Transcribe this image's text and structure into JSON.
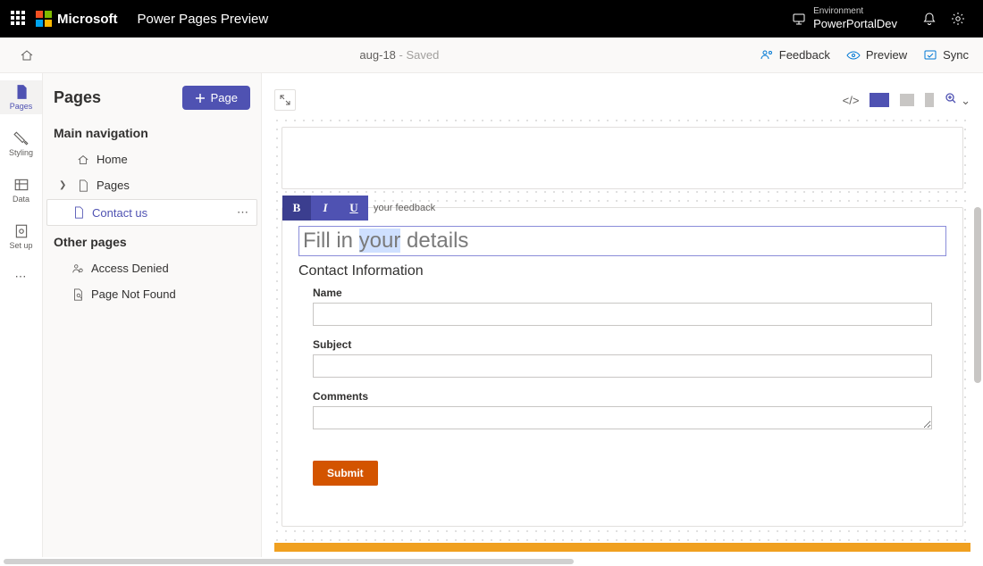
{
  "topbar": {
    "brand": "Microsoft",
    "product": "Power Pages Preview",
    "env_label": "Environment",
    "env_name": "PowerPortalDev"
  },
  "cmdbar": {
    "doc_name": "aug-18",
    "saved_suffix": " - Saved",
    "feedback": "Feedback",
    "preview": "Preview",
    "sync": "Sync"
  },
  "rail": {
    "pages": "Pages",
    "styling": "Styling",
    "data": "Data",
    "setup": "Set up"
  },
  "panel": {
    "title": "Pages",
    "add_page": "Page",
    "main_nav": "Main navigation",
    "other_pages": "Other pages",
    "items": {
      "home": "Home",
      "pages": "Pages",
      "contact": "Contact us",
      "access_denied": "Access Denied",
      "not_found": "Page Not Found"
    }
  },
  "canvas": {
    "fmt_hint": "your feedback",
    "heading_pre": "Fill in ",
    "heading_hl": "your",
    "heading_post": " details",
    "section": "Contact Information",
    "fields": {
      "name": "Name",
      "subject": "Subject",
      "comments": "Comments"
    },
    "submit": "Submit"
  }
}
